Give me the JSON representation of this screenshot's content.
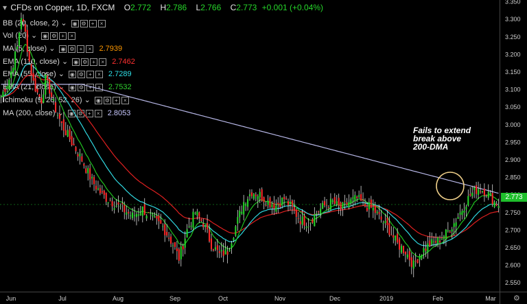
{
  "header": {
    "symbol_title": "CFDs on Copper, 1D, FXCM",
    "o_label": "O",
    "o_value": "2.772",
    "h_label": "H",
    "h_value": "2.786",
    "l_label": "L",
    "l_value": "2.766",
    "c_label": "C",
    "c_value": "2.773",
    "change": "+0.001 (+0.04%)"
  },
  "indicators": [
    {
      "name": "BB (20, close, 2)",
      "value": "",
      "color": "#d0d0d0"
    },
    {
      "name": "Vol (20)",
      "value": "",
      "color": "#d0d0d0"
    },
    {
      "name": "MA (5, close)",
      "value": "2.7939",
      "color": "#ff9800"
    },
    {
      "name": "EMA (110, close)",
      "value": "2.7462",
      "color": "#ff3030"
    },
    {
      "name": "EMA (55, close)",
      "value": "2.7289",
      "color": "#2fe0e8"
    },
    {
      "name": "EMA (21, close)",
      "value": "2.7532",
      "color": "#2fd02f"
    },
    {
      "name": "Ichimoku (9, 26, 52, 26)",
      "value": "",
      "color": "#d0d0d0"
    },
    {
      "name": "MA (200, close)",
      "value": "2.8053",
      "color": "#c8c8ff"
    }
  ],
  "annotation": {
    "line1": "Fails to extend",
    "line2": "break above",
    "line3": "200-DMA"
  },
  "last_price": "2.773",
  "colors": {
    "up": "#26d62a",
    "down": "#ff2a2a",
    "ma200": "#b8b8e8",
    "ema110": "#e02020",
    "ema55": "#30d8e0",
    "ema21": "#20c020",
    "circle": "#f0d08a"
  },
  "chart_data": {
    "type": "candlestick",
    "x_labels": [
      "Jun",
      "Jul",
      "Aug",
      "Sep",
      "Oct",
      "Nov",
      "Dec",
      "2019",
      "Feb",
      "Mar"
    ],
    "y_ticks": [
      "3.350",
      "3.300",
      "3.250",
      "3.200",
      "3.150",
      "3.100",
      "3.050",
      "3.000",
      "2.950",
      "2.900",
      "2.850",
      "2.800",
      "2.750",
      "2.700",
      "2.650",
      "2.600",
      "2.550"
    ],
    "ylim": [
      2.525,
      3.355
    ],
    "close_path": [
      [
        0,
        3.08
      ],
      [
        4,
        3.13
      ],
      [
        8,
        3.22
      ],
      [
        10,
        3.31
      ],
      [
        12,
        3.26
      ],
      [
        14,
        3.18
      ],
      [
        16,
        3.12
      ],
      [
        18,
        3.09
      ],
      [
        20,
        3.07
      ],
      [
        22,
        3.13
      ],
      [
        24,
        3.1
      ],
      [
        26,
        3.06
      ],
      [
        30,
        3.0
      ],
      [
        35,
        2.95
      ],
      [
        40,
        2.9
      ],
      [
        45,
        2.84
      ],
      [
        50,
        2.8
      ],
      [
        55,
        2.78
      ],
      [
        60,
        2.76
      ],
      [
        65,
        2.74
      ],
      [
        70,
        2.76
      ],
      [
        75,
        2.73
      ],
      [
        80,
        2.71
      ],
      [
        85,
        2.66
      ],
      [
        88,
        2.62
      ],
      [
        92,
        2.7
      ],
      [
        96,
        2.75
      ],
      [
        100,
        2.72
      ],
      [
        104,
        2.66
      ],
      [
        108,
        2.63
      ],
      [
        112,
        2.64
      ],
      [
        116,
        2.71
      ],
      [
        120,
        2.78
      ],
      [
        124,
        2.81
      ],
      [
        128,
        2.8
      ],
      [
        132,
        2.78
      ],
      [
        136,
        2.77
      ],
      [
        140,
        2.79
      ],
      [
        144,
        2.76
      ],
      [
        148,
        2.73
      ],
      [
        152,
        2.72
      ],
      [
        156,
        2.75
      ],
      [
        160,
        2.77
      ],
      [
        164,
        2.78
      ],
      [
        168,
        2.76
      ],
      [
        172,
        2.78
      ],
      [
        176,
        2.79
      ],
      [
        180,
        2.77
      ],
      [
        184,
        2.76
      ],
      [
        188,
        2.73
      ],
      [
        192,
        2.7
      ],
      [
        196,
        2.66
      ],
      [
        200,
        2.64
      ],
      [
        204,
        2.6
      ],
      [
        208,
        2.64
      ],
      [
        212,
        2.66
      ],
      [
        216,
        2.67
      ],
      [
        220,
        2.69
      ],
      [
        224,
        2.72
      ],
      [
        228,
        2.76
      ],
      [
        232,
        2.8
      ],
      [
        236,
        2.82
      ],
      [
        240,
        2.81
      ],
      [
        244,
        2.78
      ],
      [
        246,
        2.773
      ]
    ],
    "bar_count": 247
  }
}
